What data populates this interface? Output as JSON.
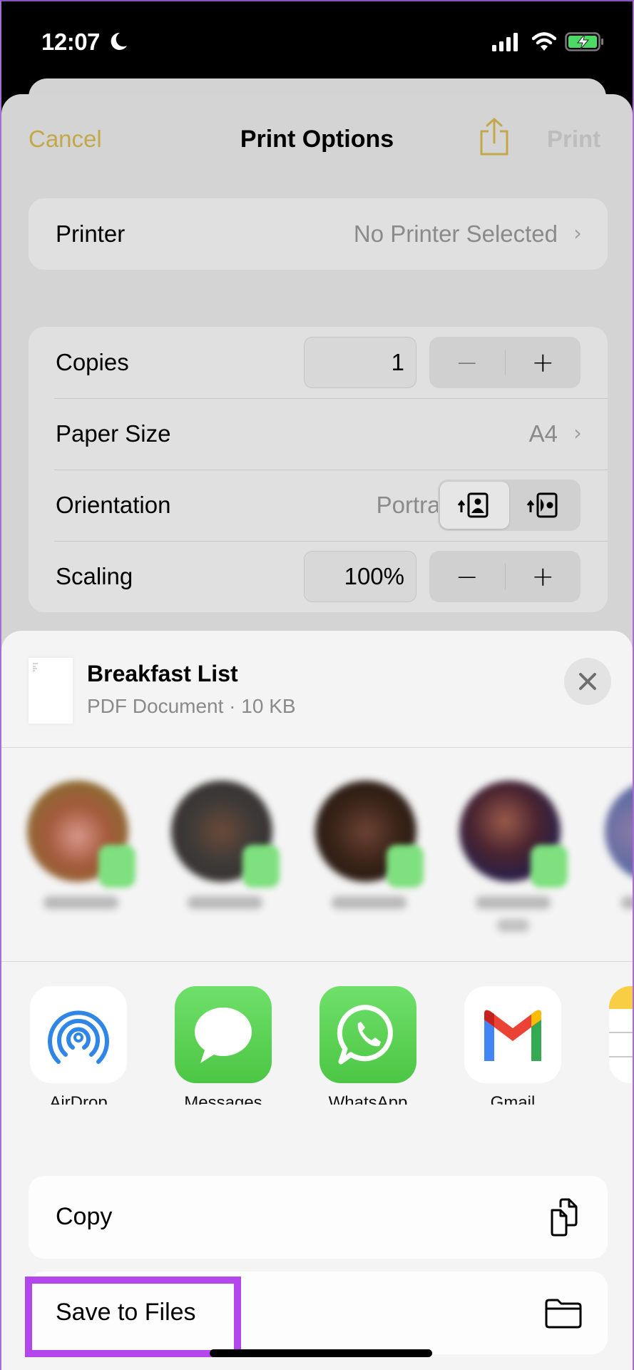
{
  "status_bar": {
    "time": "12:07",
    "focus_icon": "moon-icon",
    "signal_icon": "cellular-signal-icon",
    "wifi_icon": "wifi-icon",
    "battery_icon": "battery-charging-icon",
    "battery_color": "#4cd964"
  },
  "print_options": {
    "cancel_label": "Cancel",
    "title": "Print Options",
    "share_icon": "share-icon",
    "print_label": "Print",
    "accent_color": "#c3a84a",
    "printer": {
      "label": "Printer",
      "value": "No Printer Selected"
    },
    "copies": {
      "label": "Copies",
      "value": "1",
      "minus": "−",
      "plus": "+"
    },
    "paper_size": {
      "label": "Paper Size",
      "value": "A4"
    },
    "orientation": {
      "label": "Orientation",
      "value": "Portrait",
      "options": [
        "portrait-icon",
        "landscape-icon"
      ],
      "selected": "portrait"
    },
    "scaling": {
      "label": "Scaling",
      "value": "100%",
      "minus": "−",
      "plus": "+"
    }
  },
  "share_sheet": {
    "document": {
      "title": "Breakfast List",
      "subtitle": "PDF Document · 10 KB"
    },
    "close_icon": "close-icon",
    "contacts_note": "contact avatars and names are blurred",
    "apps": [
      {
        "label": "AirDrop",
        "icon": "airdrop-icon"
      },
      {
        "label": "Messages",
        "icon": "messages-icon"
      },
      {
        "label": "WhatsApp",
        "icon": "whatsapp-icon"
      },
      {
        "label": "Gmail",
        "icon": "gmail-icon"
      },
      {
        "label": "",
        "icon": "notes-icon"
      }
    ],
    "actions": [
      {
        "label": "Copy",
        "icon": "copy-icon"
      },
      {
        "label": "Save to Files",
        "icon": "folder-icon"
      }
    ]
  },
  "annotation": {
    "highlight_color": "#b446ee",
    "target": "Save to Files"
  }
}
